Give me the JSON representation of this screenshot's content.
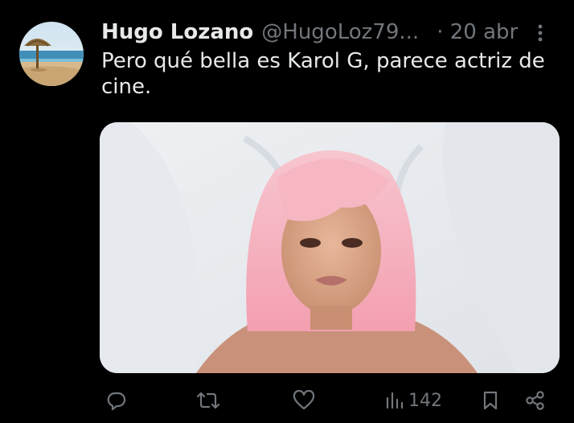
{
  "tweet": {
    "author_name": "Hugo Lozano",
    "author_handle": "@HugoLoz79...",
    "timestamp": "· 20 abr",
    "text": "Pero qué bella es Karol G, parece actriz de cine."
  },
  "actions": {
    "reply_icon": "reply-icon",
    "retweet_icon": "retweet-icon",
    "like_icon": "heart-icon",
    "views_icon": "bar-chart-icon",
    "views_count": "142",
    "bookmark_icon": "bookmark-icon",
    "share_icon": "share-icon"
  },
  "colors": {
    "background": "#000000",
    "primary_text": "#e7e9ea",
    "secondary_text": "#71767b"
  }
}
